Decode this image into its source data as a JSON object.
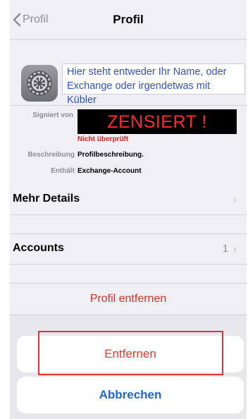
{
  "nav": {
    "back_label": "Profil",
    "title": "Profil"
  },
  "profile": {
    "name_line_1": "Hier steht entweder Ihr Name, oder",
    "name_line_2": "Exchange oder irgendetwas mit Kübler"
  },
  "details": {
    "signed_by_label": "Signiert von",
    "signed_by_value": "ZENSIERT !",
    "verification_status": "Nicht überprüft",
    "description_label": "Beschreibung",
    "description_value": "Profilbeschreibung.",
    "contains_label": "Enthält",
    "contains_value": "Exchange-Account"
  },
  "more_details": {
    "label": "Mehr Details"
  },
  "accounts": {
    "label": "Accounts",
    "count": "1"
  },
  "actions": {
    "remove_profile": "Profil entfernen",
    "confirm_remove": "Entfernen",
    "cancel": "Abbrechen"
  },
  "colors": {
    "destructive": "#e03b2f",
    "accent": "#1a67d6",
    "highlight_box": "#e0333a",
    "profile_text": "#2f52c9"
  },
  "icons": {
    "profile_icon": "gear-icon",
    "back_icon": "chevron-left-icon",
    "row_chevron": "chevron-right-icon"
  }
}
